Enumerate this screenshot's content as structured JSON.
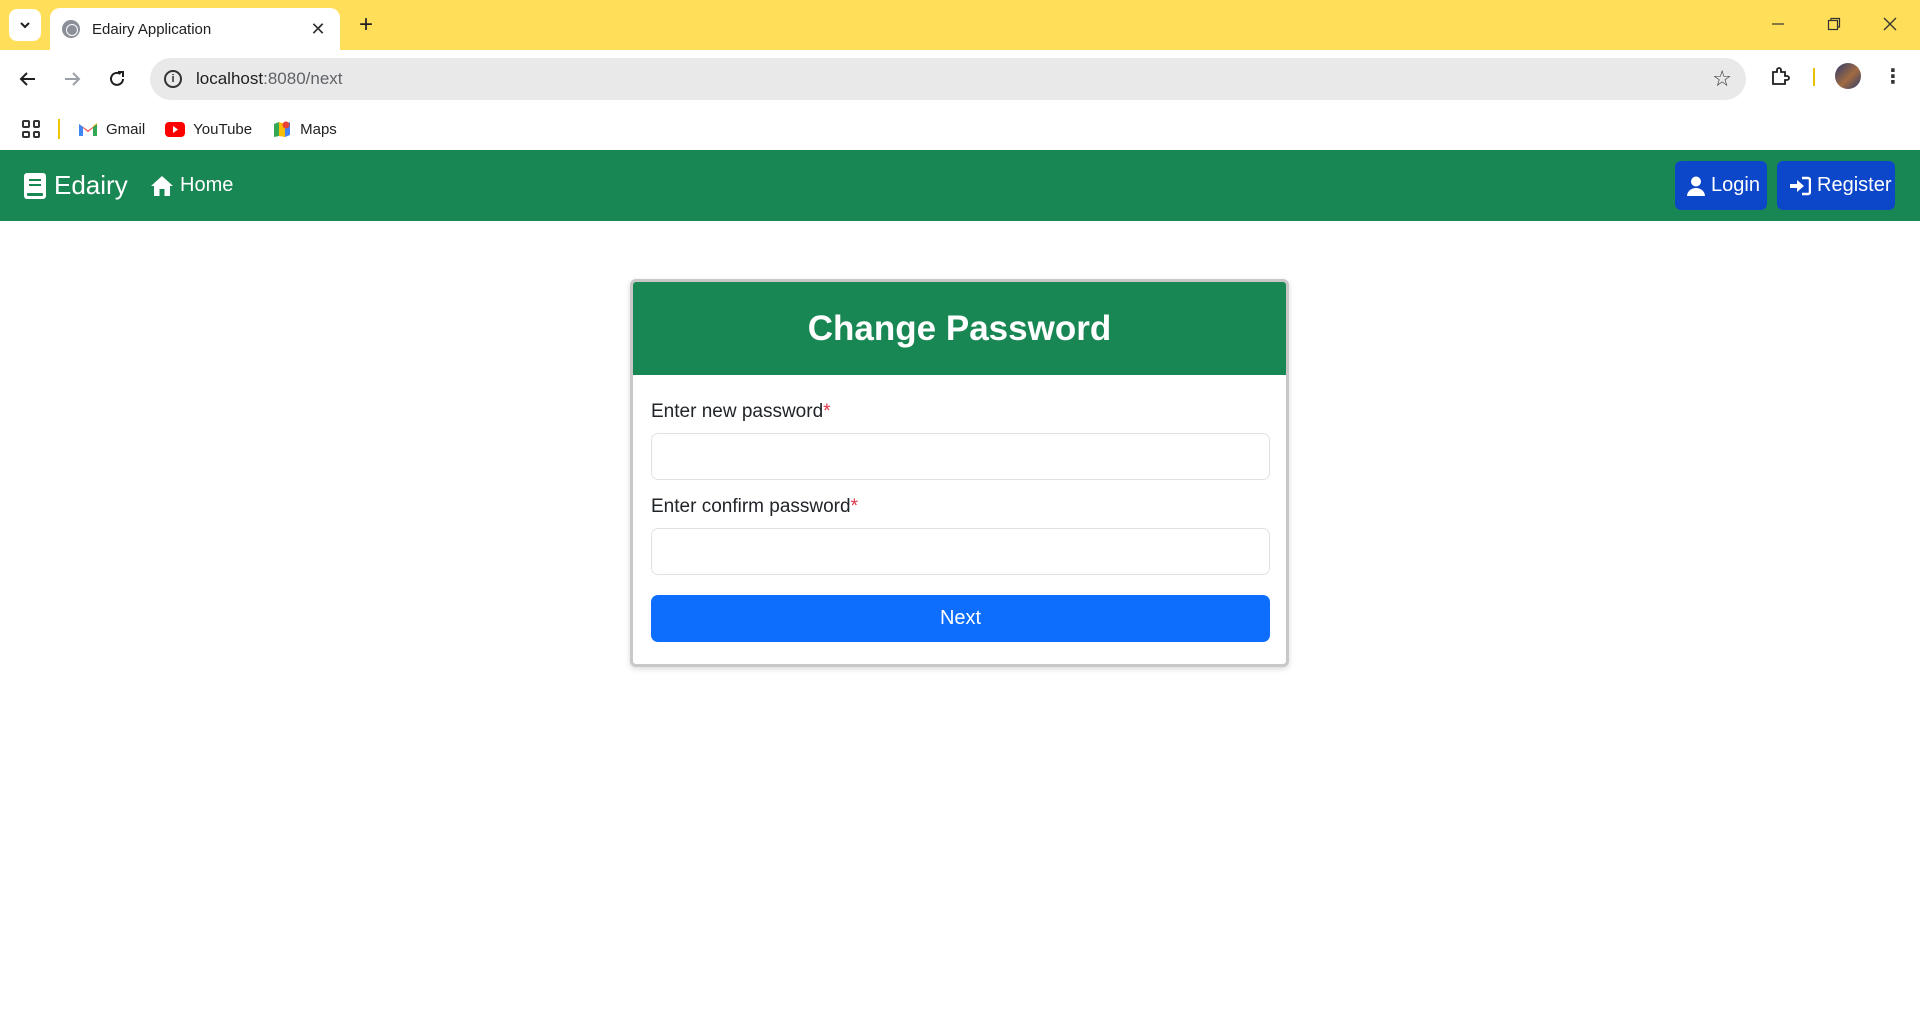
{
  "browser": {
    "tab_title": "Edairy Application",
    "url_host": "localhost",
    "url_rest": ":8080/next",
    "bookmarks": [
      {
        "label": "Gmail",
        "icon": "gmail-icon"
      },
      {
        "label": "YouTube",
        "icon": "youtube-icon"
      },
      {
        "label": "Maps",
        "icon": "maps-icon"
      }
    ]
  },
  "navbar": {
    "brand": "Edairy",
    "home": "Home",
    "login": "Login",
    "register": "Register",
    "color": "#198754",
    "button_color": "#0d47c9"
  },
  "card": {
    "title": "Change Password",
    "new_password_label": "Enter new password",
    "confirm_password_label": "Enter confirm password",
    "required_mark": "*",
    "new_password_value": "",
    "confirm_password_value": "",
    "submit_label": "Next",
    "submit_color": "#0d6efd"
  }
}
